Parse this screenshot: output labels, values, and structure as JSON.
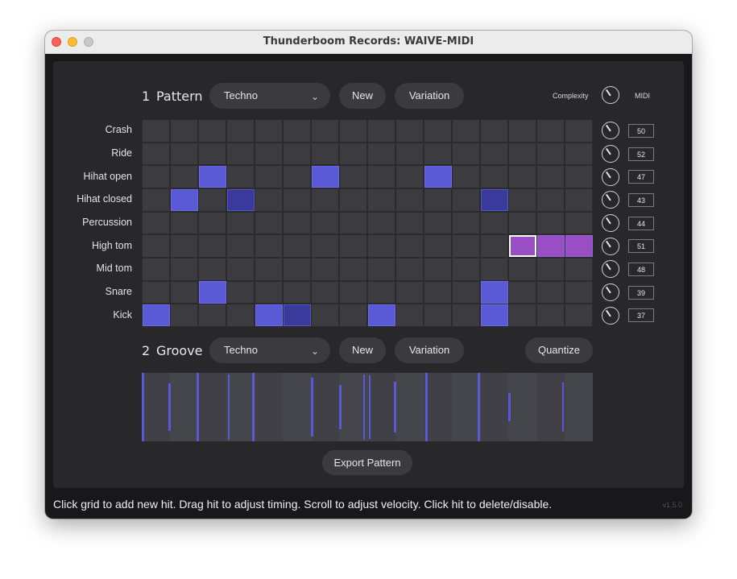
{
  "window": {
    "title": "Thunderboom Records: WAIVE-MIDI"
  },
  "pattern": {
    "number": "1",
    "title": "Pattern",
    "dropdown_value": "Techno",
    "new_label": "New",
    "variation_label": "Variation",
    "complexity_label": "Complexity",
    "midi_label": "MIDI",
    "rows": [
      {
        "label": "Crash",
        "midi": "50"
      },
      {
        "label": "Ride",
        "midi": "52"
      },
      {
        "label": "Hihat open",
        "midi": "47"
      },
      {
        "label": "Hihat closed",
        "midi": "43"
      },
      {
        "label": "Percussion",
        "midi": "44"
      },
      {
        "label": "High tom",
        "midi": "51"
      },
      {
        "label": "Mid tom",
        "midi": "48"
      },
      {
        "label": "Snare",
        "midi": "39"
      },
      {
        "label": "Kick",
        "midi": "37"
      }
    ],
    "steps": 16,
    "hits": [
      {
        "row": 2,
        "step": 2,
        "velocity": 0.8
      },
      {
        "row": 2,
        "step": 6,
        "velocity": 0.8
      },
      {
        "row": 2,
        "step": 10,
        "velocity": 0.8
      },
      {
        "row": 3,
        "step": 1,
        "velocity": 0.8
      },
      {
        "row": 3,
        "step": 3,
        "velocity": 0.45
      },
      {
        "row": 3,
        "step": 12,
        "velocity": 0.45
      },
      {
        "row": 5,
        "step": 13,
        "velocity": 0.9,
        "selected": true
      },
      {
        "row": 5,
        "step": 14,
        "velocity": 0.9
      },
      {
        "row": 5,
        "step": 15,
        "velocity": 0.9
      },
      {
        "row": 7,
        "step": 2,
        "velocity": 0.6
      },
      {
        "row": 7,
        "step": 12,
        "velocity": 0.8
      },
      {
        "row": 8,
        "step": 0,
        "velocity": 0.8
      },
      {
        "row": 8,
        "step": 4,
        "velocity": 0.8
      },
      {
        "row": 8,
        "step": 5,
        "velocity": 0.45
      },
      {
        "row": 8,
        "step": 8,
        "velocity": 0.8
      },
      {
        "row": 8,
        "step": 12,
        "velocity": 0.8
      }
    ],
    "colors": {
      "hit_bright": "#5a5ad6",
      "hit_dark": "#3a3a9c",
      "hit_tom": "#9a4ec4",
      "cell": "#3b3b40"
    }
  },
  "groove": {
    "number": "2",
    "title": "Groove",
    "dropdown_value": "Techno",
    "new_label": "New",
    "variation_label": "Variation",
    "quantize_label": "Quantize",
    "lines": [
      {
        "step": 0.0,
        "level": 1.0
      },
      {
        "step": 0.95,
        "level": 0.7
      },
      {
        "step": 1.95,
        "level": 1.0
      },
      {
        "step": 3.05,
        "level": 0.95
      },
      {
        "step": 3.9,
        "level": 1.0
      },
      {
        "step": 6.0,
        "level": 0.85
      },
      {
        "step": 7.0,
        "level": 0.65
      },
      {
        "step": 7.85,
        "level": 0.95
      },
      {
        "step": 8.05,
        "level": 0.92
      },
      {
        "step": 8.95,
        "level": 0.75
      },
      {
        "step": 10.05,
        "level": 1.0
      },
      {
        "step": 11.9,
        "level": 1.0
      },
      {
        "step": 13.0,
        "level": 0.42
      },
      {
        "step": 14.9,
        "level": 0.72
      }
    ]
  },
  "export_label": "Export Pattern",
  "status_text": "Click grid to add new hit. Drag hit to adjust timing. Scroll to adjust velocity. Click hit to delete/disable.",
  "version": "v1.5.0"
}
